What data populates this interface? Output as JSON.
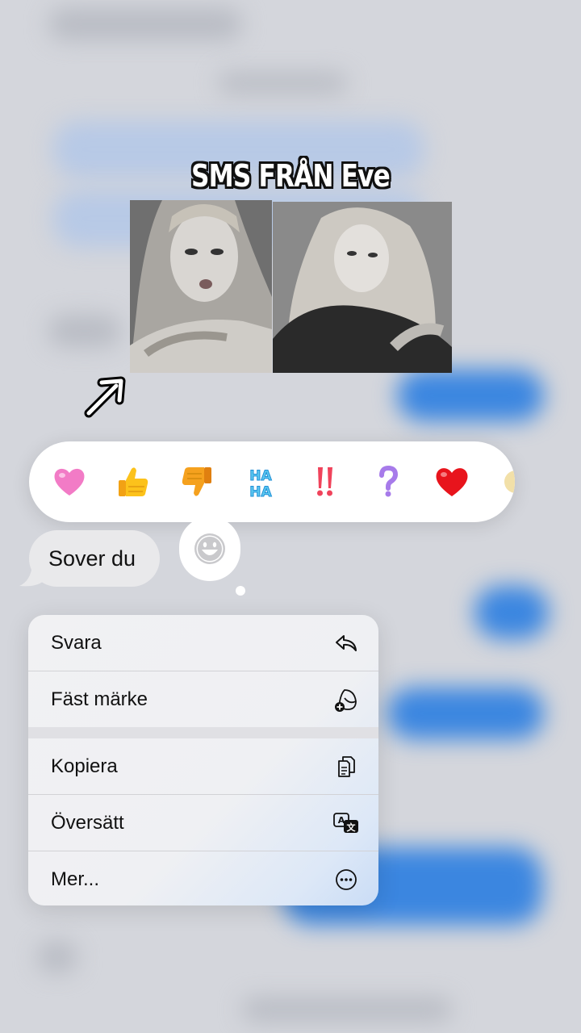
{
  "overlay_title": "SMS FRÅN Eve",
  "message": {
    "text": "Sover du"
  },
  "reactions": [
    {
      "name": "pink-heart"
    },
    {
      "name": "thumbs-up"
    },
    {
      "name": "thumbs-down"
    },
    {
      "name": "haha"
    },
    {
      "name": "double-exclamation"
    },
    {
      "name": "question-mark"
    },
    {
      "name": "red-heart"
    }
  ],
  "menu": {
    "items": [
      {
        "label": "Svara",
        "icon": "reply-icon"
      },
      {
        "label": "Fäst märke",
        "icon": "sticker-add-icon"
      },
      {
        "label": "Kopiera",
        "icon": "copy-icon"
      },
      {
        "label": "Översätt",
        "icon": "translate-icon"
      },
      {
        "label": "Mer...",
        "icon": "more-icon"
      }
    ]
  },
  "colors": {
    "accent_blue": "#3b86e0",
    "bubble_grey": "#e9e9eb",
    "background": "#d4d6dc"
  }
}
